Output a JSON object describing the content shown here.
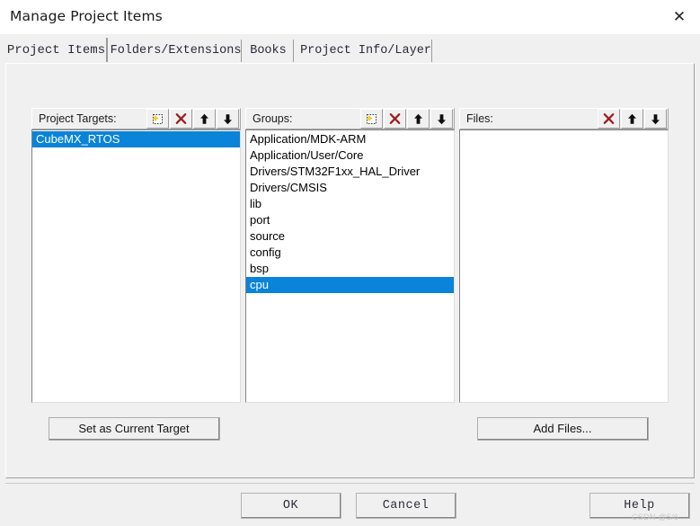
{
  "window": {
    "title": "Manage Project Items",
    "close_icon": "close-icon",
    "close_glyph": "✕"
  },
  "tabs": [
    {
      "label": "Project Items",
      "selected": true
    },
    {
      "label": "Folders/Extensions",
      "selected": false
    },
    {
      "label": "Books",
      "selected": false
    },
    {
      "label": "Project Info/Layer",
      "selected": false
    }
  ],
  "columns": {
    "targets": {
      "label": "Project Targets:",
      "buttons": [
        {
          "icon": "new-item-icon",
          "title": "New"
        },
        {
          "icon": "delete-x-icon",
          "title": "Remove"
        },
        {
          "icon": "arrow-up-icon",
          "title": "Move Up"
        },
        {
          "icon": "arrow-down-icon",
          "title": "Move Down"
        }
      ],
      "items": [
        {
          "label": "CubeMX_RTOS",
          "selected": true
        }
      ]
    },
    "groups": {
      "label": "Groups:",
      "buttons": [
        {
          "icon": "new-item-icon",
          "title": "New"
        },
        {
          "icon": "delete-x-icon",
          "title": "Remove"
        },
        {
          "icon": "arrow-up-icon",
          "title": "Move Up"
        },
        {
          "icon": "arrow-down-icon",
          "title": "Move Down"
        }
      ],
      "items": [
        {
          "label": "Application/MDK-ARM",
          "selected": false
        },
        {
          "label": "Application/User/Core",
          "selected": false
        },
        {
          "label": "Drivers/STM32F1xx_HAL_Driver",
          "selected": false
        },
        {
          "label": "Drivers/CMSIS",
          "selected": false
        },
        {
          "label": "lib",
          "selected": false
        },
        {
          "label": "port",
          "selected": false
        },
        {
          "label": "source",
          "selected": false
        },
        {
          "label": "config",
          "selected": false
        },
        {
          "label": "bsp",
          "selected": false
        },
        {
          "label": "cpu",
          "selected": true
        }
      ]
    },
    "files": {
      "label": "Files:",
      "buttons": [
        {
          "icon": "delete-x-icon",
          "title": "Remove"
        },
        {
          "icon": "arrow-up-icon",
          "title": "Move Up"
        },
        {
          "icon": "arrow-down-icon",
          "title": "Move Down"
        }
      ],
      "items": []
    }
  },
  "actions": {
    "set_current_target": "Set as Current Target",
    "add_files": "Add Files..."
  },
  "footer": {
    "ok": "OK",
    "cancel": "Cancel",
    "help": "Help"
  },
  "watermark": {
    "text": "CSDN @5/6"
  },
  "colors": {
    "selection_blue": "#0a84d8",
    "dialog_face": "#f0f0f0",
    "delete_red": "#9e1b1b",
    "listbox_white": "#ffffff"
  }
}
